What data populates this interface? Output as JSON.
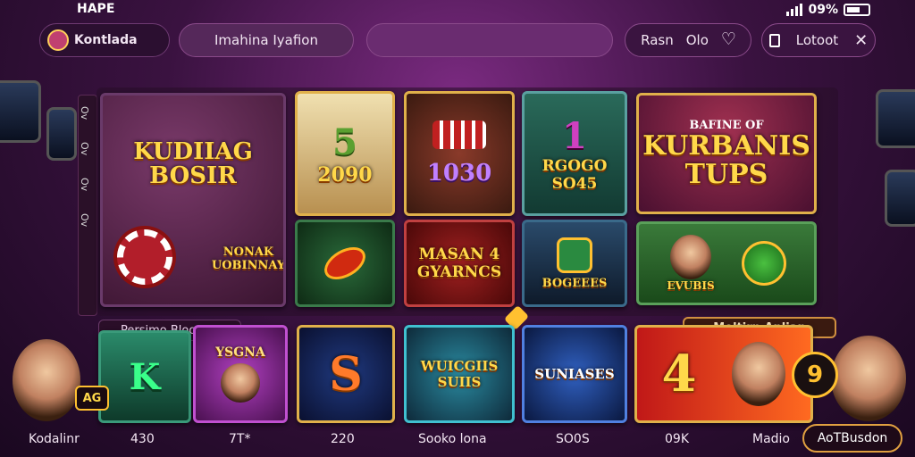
{
  "status": {
    "time": "HAPE",
    "battery": "09%"
  },
  "top": {
    "logo_text": "Kontlada",
    "search_placeholder": "Imahina Iyafion",
    "favorites_label": "Rasn",
    "favorites_sub": "Olo",
    "lotto_label": "Lotoot"
  },
  "tabs": [
    "Ov",
    "Ov",
    "Ov",
    "Ov"
  ],
  "grid": {
    "t1": {
      "title": "KUDIIAG BOSIR",
      "sub": "NONAK UOBINNAY"
    },
    "t2": {
      "num": "5",
      "label": "2090"
    },
    "t3": {
      "label": "1030"
    },
    "t4": {
      "num": "1",
      "label": "RGOGO SO45"
    },
    "t5": {
      "top": "BAFINE OF",
      "title": "KURBANIS TUPS"
    },
    "t6": {
      "label": "MASAN 4 GYARNCS"
    },
    "t7": {
      "label": "BOGEEES"
    },
    "t8": {
      "label": "EVUBIS"
    }
  },
  "sections": {
    "left_tag": "Persimo Bloosika",
    "right_tag": "Moltirp Anlian",
    "side_badge": "AG"
  },
  "bottom": {
    "tiles": [
      {
        "art": "K"
      },
      {
        "art": "YSGNA"
      },
      {
        "art": "S"
      },
      {
        "art": "WUICGIIS SUIIS"
      },
      {
        "art": "SUNIASES"
      },
      {
        "art": "4"
      }
    ],
    "labels": [
      "Kodalinr",
      "430",
      "7T*",
      "220",
      "Sooko lona",
      "SO0S",
      "09K",
      "Madio"
    ],
    "action": "AoTBusdon"
  },
  "colors": {
    "accent": "#ffd84a",
    "bg": "#3a1240"
  }
}
